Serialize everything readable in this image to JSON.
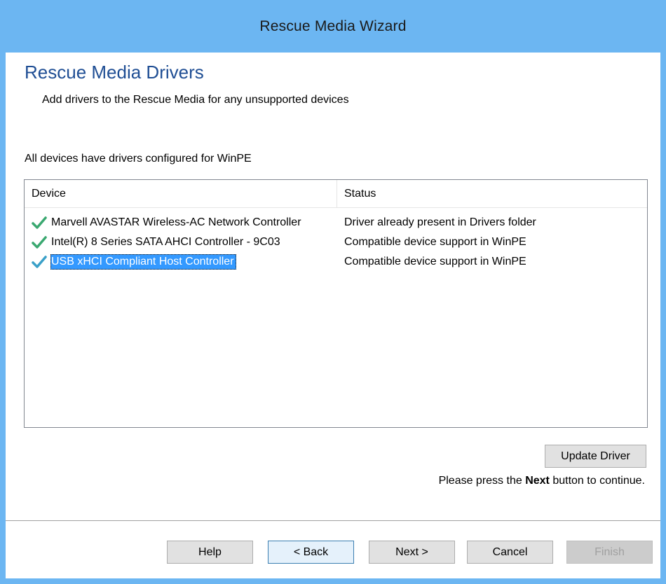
{
  "window": {
    "title": "Rescue Media Wizard"
  },
  "page": {
    "heading": "Rescue Media Drivers",
    "subheading": "Add drivers to the Rescue Media for any unsupported devices",
    "info": "All devices have drivers configured for WinPE"
  },
  "devices": {
    "columns": {
      "device": "Device",
      "status": "Status"
    },
    "rows": [
      {
        "device": "Marvell AVASTAR Wireless-AC Network Controller",
        "status": "Driver already present in Drivers folder",
        "icon": "check-icon"
      },
      {
        "device": "Intel(R) 8 Series SATA AHCI Controller - 9C03",
        "status": "Compatible device support in WinPE",
        "icon": "check-icon"
      },
      {
        "device": "USB xHCI Compliant Host Controller",
        "status": "Compatible device support in WinPE",
        "icon": "check-icon",
        "selected": true
      }
    ]
  },
  "actions": {
    "update_driver": "Update Driver",
    "hint_prefix": "Please press the",
    "hint_bold": "Next",
    "hint_suffix": "button to continue."
  },
  "footer": {
    "help": "Help",
    "back": "< Back",
    "next": "Next >",
    "cancel": "Cancel",
    "finish": "Finish"
  },
  "colors": {
    "titlebar": "#6cb6f2",
    "heading": "#1f4e94",
    "selection": "#3399ff",
    "check": "#3aa870"
  }
}
